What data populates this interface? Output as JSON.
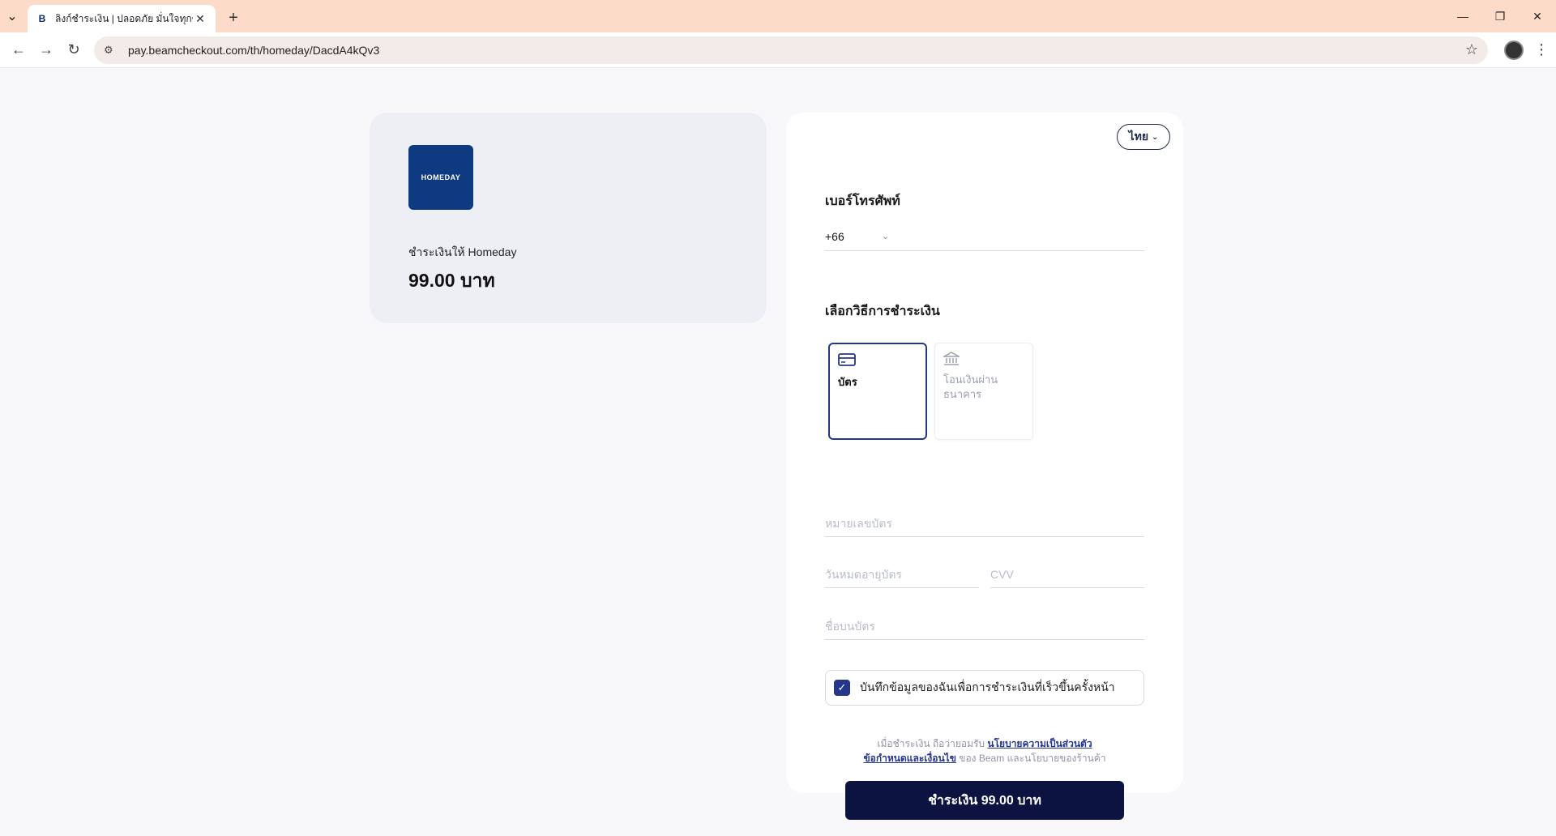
{
  "browser": {
    "tab_title": "ลิงก์ชำระเงิน | ปลอดภัย มั่นใจทุกช่อง",
    "tab_favicon": "B",
    "url": "pay.beamcheckout.com/th/homeday/DacdA4kQv3"
  },
  "merchant": {
    "logo_text": "HOMEDAY",
    "pay_to": "ชำระเงินให้ Homeday",
    "amount": "99.00 บาท"
  },
  "form": {
    "language": "ไทย",
    "phone_label": "เบอร์โทรศัพท์",
    "phone_code": "+66",
    "method_label": "เลือกวิธีการชำระเงิน",
    "methods": [
      {
        "label": "บัตร",
        "icon": "credit-card-icon"
      },
      {
        "label": "โอนเงินผ่านธนาคาร",
        "icon": "bank-icon"
      }
    ],
    "card_number_placeholder": "หมายเลขบัตร",
    "expiry_placeholder": "วันหมดอายุบัตร",
    "cvv_placeholder": "CVV",
    "card_name_placeholder": "ชื่อบนบัตร",
    "save_info_label": "บันทึกข้อมูลของฉันเพื่อการชำระเงินที่เร็วขึ้นครั้งหน้า",
    "terms_prefix": "เมื่อชำระเงิน ถือว่ายอมรับ",
    "privacy_link": "นโยบายความเป็นส่วนตัว",
    "terms_link": "ข้อกำหนดและเงื่อนไข",
    "terms_suffix": "ของ Beam และนโยบายของร้านค้า",
    "pay_button": "ชำระเงิน 99.00 บาท"
  },
  "colors": {
    "accent": "#26368a",
    "button": "#0c1340",
    "tabbar": "#fcdcc8"
  }
}
